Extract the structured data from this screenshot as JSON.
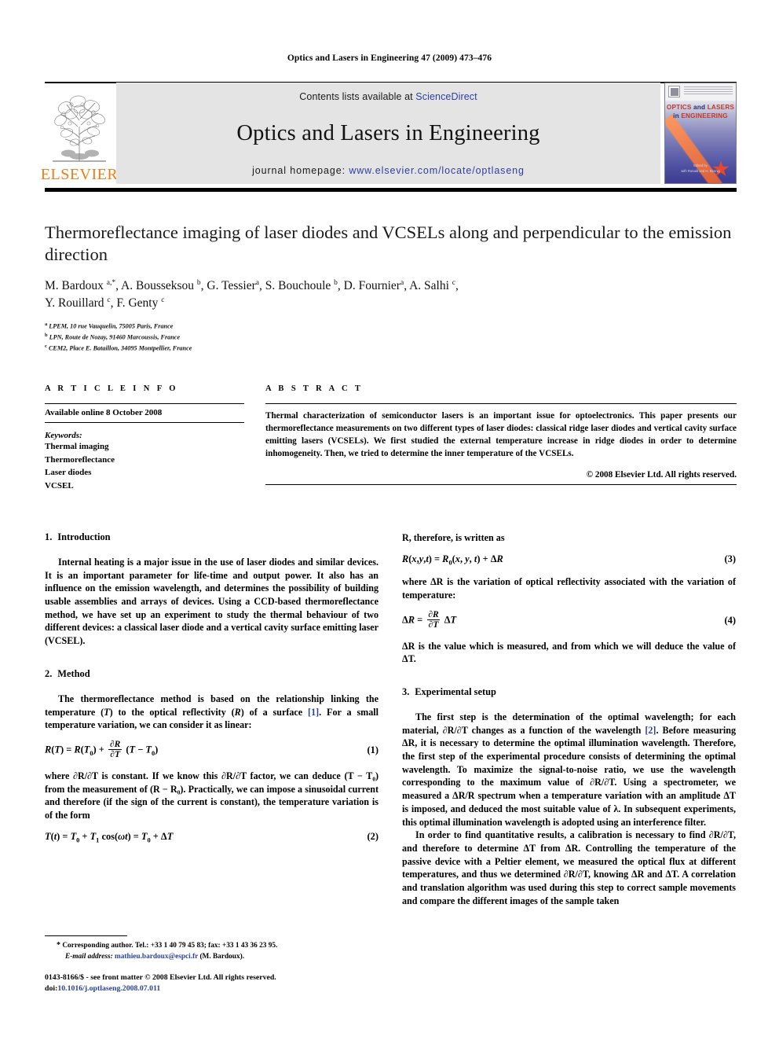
{
  "running_head": "Optics and Lasers in Engineering 47 (2009) 473–476",
  "masthead": {
    "elsevier_wordmark": "ELSEVIER",
    "contents_prefix": "Contents lists available at ",
    "sciencedirect": "ScienceDirect",
    "journal_name": "Optics and Lasers in Engineering",
    "homepage_prefix": "journal homepage: ",
    "homepage_url": "www.elsevier.com/locate/optlaseng",
    "cover": {
      "title_line1_a": "OPTICS",
      "title_line1_and": " and ",
      "title_line1_b": "LASERS",
      "title_line2_in": "in ",
      "title_line2_b": "ENGINEERING",
      "footer_line1": "Edited by",
      "footer_line2": "with Ronald and H. Bennig"
    },
    "accent_blue": "#2f3d9e",
    "elsevier_orange": "#f07d1a"
  },
  "article": {
    "title": "Thermoreflectance imaging of laser diodes and VCSELs along and perpendicular to the emission direction",
    "authors_line1": "M. Bardoux <sup>a,*</sup>, A. Bousseksou <sup>b</sup>, G. Tessier<sup>a</sup>, S. Bouchoule <sup>b</sup>, D. Fournier<sup>a</sup>, A. Salhi <sup>c</sup>,",
    "authors_line2": "Y. Rouillard <sup>c</sup>, F. Genty <sup>c</sup>",
    "affiliations": [
      "<sup>a</sup> LPEM, 10 rue Vauquelin, 75005 Paris, France",
      "<sup>b</sup> LPN, Route de Nozay, 91460 Marcoussis, France",
      "<sup>c</sup> CEM2, Place E. Bataillon, 34095 Montpellier, France"
    ]
  },
  "info": {
    "heading": "A R T I C L E   I N F O",
    "available_online": "Available online 8 October 2008",
    "keywords_label": "Keywords:",
    "keywords": [
      "Thermal imaging",
      "Thermoreflectance",
      "Laser diodes",
      "VCSEL"
    ]
  },
  "abstract": {
    "heading": "A B S T R A C T",
    "text": "Thermal characterization of semiconductor lasers is an important issue for optoelectronics. This paper presents our thermoreflectance measurements on two different types of laser diodes: classical ridge laser diodes and vertical cavity surface emitting lasers (VCSELs). We first studied the external temperature increase in ridge diodes in order to determine inhomogeneity. Then, we tried to determine the inner temperature of the VCSELs.",
    "copyright": "© 2008 Elsevier Ltd. All rights reserved."
  },
  "sections": {
    "intro": {
      "number": "1.",
      "title": "Introduction",
      "paragraph": "Internal heating is a major issue in the use of laser diodes and similar devices. It is an important parameter for life-time and output power. It also has an influence on the emission wavelength, and determines the possibility of building usable assemblies and arrays of devices. Using a CCD-based thermoreflectance method, we have set up an experiment to study the thermal behaviour of two different devices: a classical laser diode and a vertical cavity surface emitting laser (VCSEL)."
    },
    "method": {
      "number": "2.",
      "title": "Method",
      "para1_a": "The thermoreflectance method is based on the relationship linking the temperature (",
      "para1_T": "T",
      "para1_b": ") to the optical reflectivity (",
      "para1_R": "R",
      "para1_c": ") of a surface ",
      "para1_ref": "[1]",
      "para1_d": ". For a small temperature variation, we can consider it as linear:",
      "eq1_num": "(1)",
      "para2": "where ∂R/∂T is constant. If we know this ∂R/∂T factor, we can deduce (T − T₀) from the measurement of (R − R₀). Practically, we can impose a sinusoidal current and therefore (if the sign of the current is constant), the temperature variation is of the form",
      "eq2_num": "(2)"
    },
    "right_top": {
      "lead": "R, therefore, is written as",
      "eq3_num": "(3)",
      "para_after_eq3": "where ΔR is the variation of optical reflectivity associated with the variation of temperature:",
      "eq4_num": "(4)",
      "para_after_eq4": "ΔR is the value which is measured, and from which we will deduce the value of ΔT."
    },
    "experimental": {
      "number": "3.",
      "title": "Experimental setup",
      "para1_a": "The first step is the determination of the optimal wavelength; for each material, ∂R/∂T changes as a function of the wavelength ",
      "para1_ref": "[2]",
      "para1_b": ". Before measuring ΔR, it is necessary to determine the optimal illumination wavelength. Therefore, the first step of the experimental procedure consists of determining the optimal wavelength. To maximize the signal-to-noise ratio, we use the wavelength corresponding to the maximum value of ∂R/∂T. Using a spectrometer, we measured a ΔR/R spectrum when a temperature variation with an amplitude ΔT is imposed, and deduced the most suitable value of λ. In subsequent experiments, this optimal illumination wavelength is adopted using an interference filter.",
      "para2": "In order to find quantitative results, a calibration is necessary to find ∂R/∂T, and therefore to determine ΔT from ΔR. Controlling the temperature of the passive device with a Peltier element, we measured the optical flux at different temperatures, and thus we determined ∂R/∂T, knowing ΔR and ΔT. A correlation and translation algorithm was used during this step to correct sample movements and compare the different images of the sample taken"
    }
  },
  "footnote": {
    "star": "*",
    "corresponding": " Corresponding author. Tel.: +33 1 40 79 45 83; fax: +33 1 43 36 23 95.",
    "email_label": "E-mail address:",
    "email": "mathieu.bardoux@espci.fr",
    "email_suffix": " (M. Bardoux).",
    "issn_line": "0143-8166/$ - see front matter © 2008 Elsevier Ltd. All rights reserved.",
    "doi_label": "doi:",
    "doi_value": "10.1016/j.optlaseng.2008.07.011"
  }
}
